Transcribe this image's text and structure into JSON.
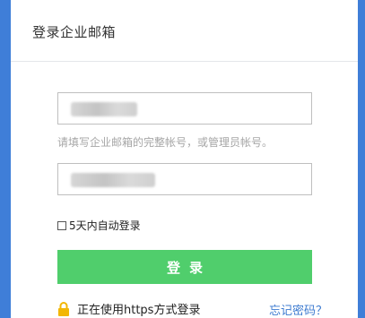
{
  "header": {
    "title": "登录企业邮箱"
  },
  "form": {
    "username_value": "●●●●●●●●",
    "password_value": "●●●●●●●●●●",
    "hint": "请填写企业邮箱的完整帐号，或管理员帐号。",
    "remember_label": "5天内自动登录",
    "remember_checked": false,
    "login_label": "登录"
  },
  "footer": {
    "https_text": "正在使用https方式登录",
    "forgot_link": "忘记密码？"
  },
  "colors": {
    "frame": "#3f7ed8",
    "button": "#50ce6c",
    "link": "#3d7bd0",
    "lock": "#f2b705"
  },
  "icons": {
    "lock": "lock-icon"
  }
}
